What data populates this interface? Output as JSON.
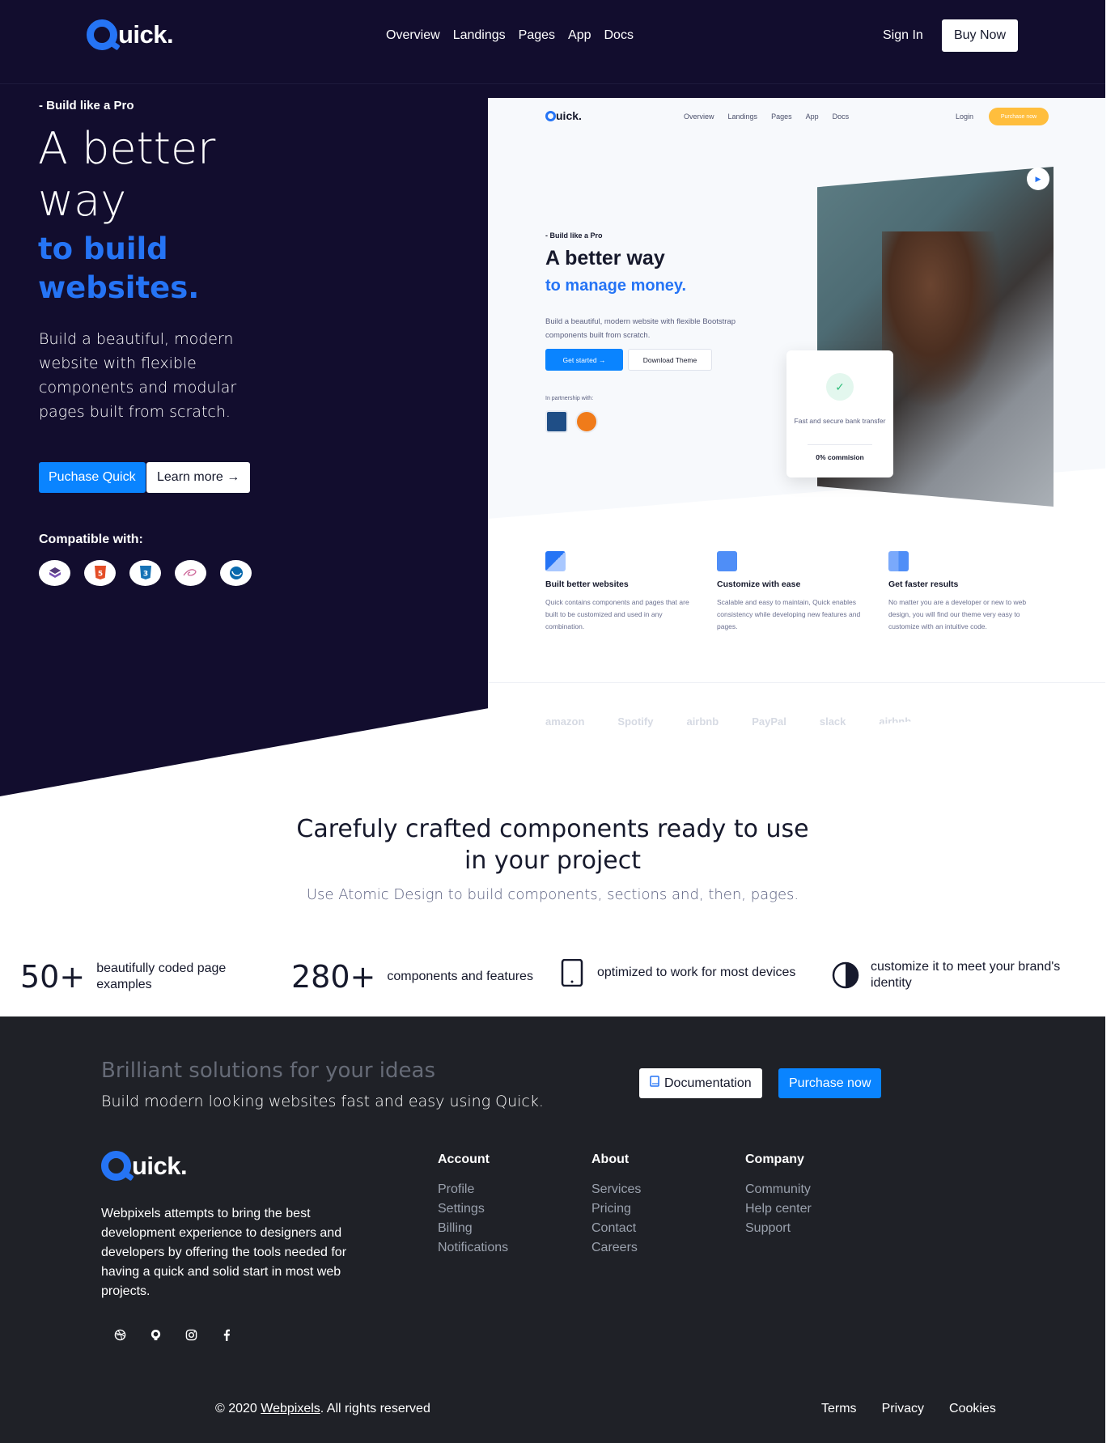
{
  "navbar": {
    "brand": "uick.",
    "links": [
      "Overview",
      "Landings",
      "Pages",
      "App",
      "Docs"
    ],
    "sign_in": "Sign In",
    "buy_now": "Buy Now"
  },
  "hero": {
    "eyebrow": "- Build like a Pro",
    "title": "A better way",
    "title_accent": "to build websites.",
    "lead": "Build a beautiful, modern website with flexible components and modular pages built from scratch.",
    "purchase_button": "Puchase Quick",
    "learn_more_button": "Learn more",
    "compatible_title": "Compatible with:",
    "compatible_icons": [
      "bootstrap-icon",
      "html5-icon",
      "css3-icon",
      "sass-icon",
      "jquery-icon"
    ]
  },
  "preview": {
    "brand": "uick.",
    "nav": [
      "Overview",
      "Landings",
      "Pages",
      "App",
      "Docs"
    ],
    "login": "Login",
    "purchase": "Purchase now",
    "eyebrow": "- Build like a Pro",
    "title": "A better way",
    "title_accent": "to manage money.",
    "lead": "Build a beautiful, modern website with flexible Bootstrap components built from scratch.",
    "get_started": "Get started →",
    "download": "Download Theme",
    "partnership": "In partnership with:",
    "card_text": "Fast and secure bank transfer",
    "card_bold": "0% commision",
    "features": [
      {
        "title": "Built better websites",
        "desc": "Quick contains components and pages that are built to be customized and used in any combination."
      },
      {
        "title": "Customize with ease",
        "desc": "Scalable and easy to maintain, Quick enables consistency while developing new features and pages."
      },
      {
        "title": "Get faster results",
        "desc": "No matter you are a developer or new to web design, you will find our theme very easy to customize with an intuitive code."
      }
    ],
    "logos": [
      "amazon",
      "Spotify",
      "airbnb",
      "PayPal",
      "slack",
      "airbnb"
    ]
  },
  "components": {
    "title": "Carefuly crafted components ready to use in your project",
    "subtitle": "Use Atomic Design to build components, sections and, then, pages."
  },
  "stats": [
    {
      "num": "50+",
      "text": "beautifully coded page examples"
    },
    {
      "num": "280+",
      "text": "components and features"
    },
    {
      "icon": "tablet-icon",
      "text": "optimized to work for most devices"
    },
    {
      "icon": "contrast-icon",
      "text": "customize it to meet your brand's identity"
    }
  ],
  "footer": {
    "cta_title": "Brilliant solutions for your ideas",
    "cta_sub": "Build modern looking websites fast and easy using Quick.",
    "docs_button": "Documentation",
    "purchase_button": "Purchase now",
    "brand": "uick.",
    "about": "Webpixels attempts to bring the best development experience to designers and developers by offering the tools needed for having a quick and solid start in most web projects.",
    "columns": [
      {
        "title": "Account",
        "links": [
          "Profile",
          "Settings",
          "Billing",
          "Notifications"
        ]
      },
      {
        "title": "About",
        "links": [
          "Services",
          "Pricing",
          "Contact",
          "Careers"
        ]
      },
      {
        "title": "Company",
        "links": [
          "Community",
          "Help center",
          "Support"
        ]
      }
    ],
    "social": [
      "dribbble-icon",
      "github-icon",
      "instagram-icon",
      "facebook-icon"
    ],
    "copyright_prefix": "© 2020 ",
    "copyright_link": "Webpixels",
    "copyright_suffix": ". All rights reserved",
    "legal": [
      "Terms",
      "Privacy",
      "Cookies"
    ]
  },
  "colors": {
    "navy": "#120d2e",
    "accent": "#2574f5",
    "button_blue": "#0a84ff",
    "footer_bg": "#1f2127",
    "preview_orange": "#ffbe3d"
  }
}
